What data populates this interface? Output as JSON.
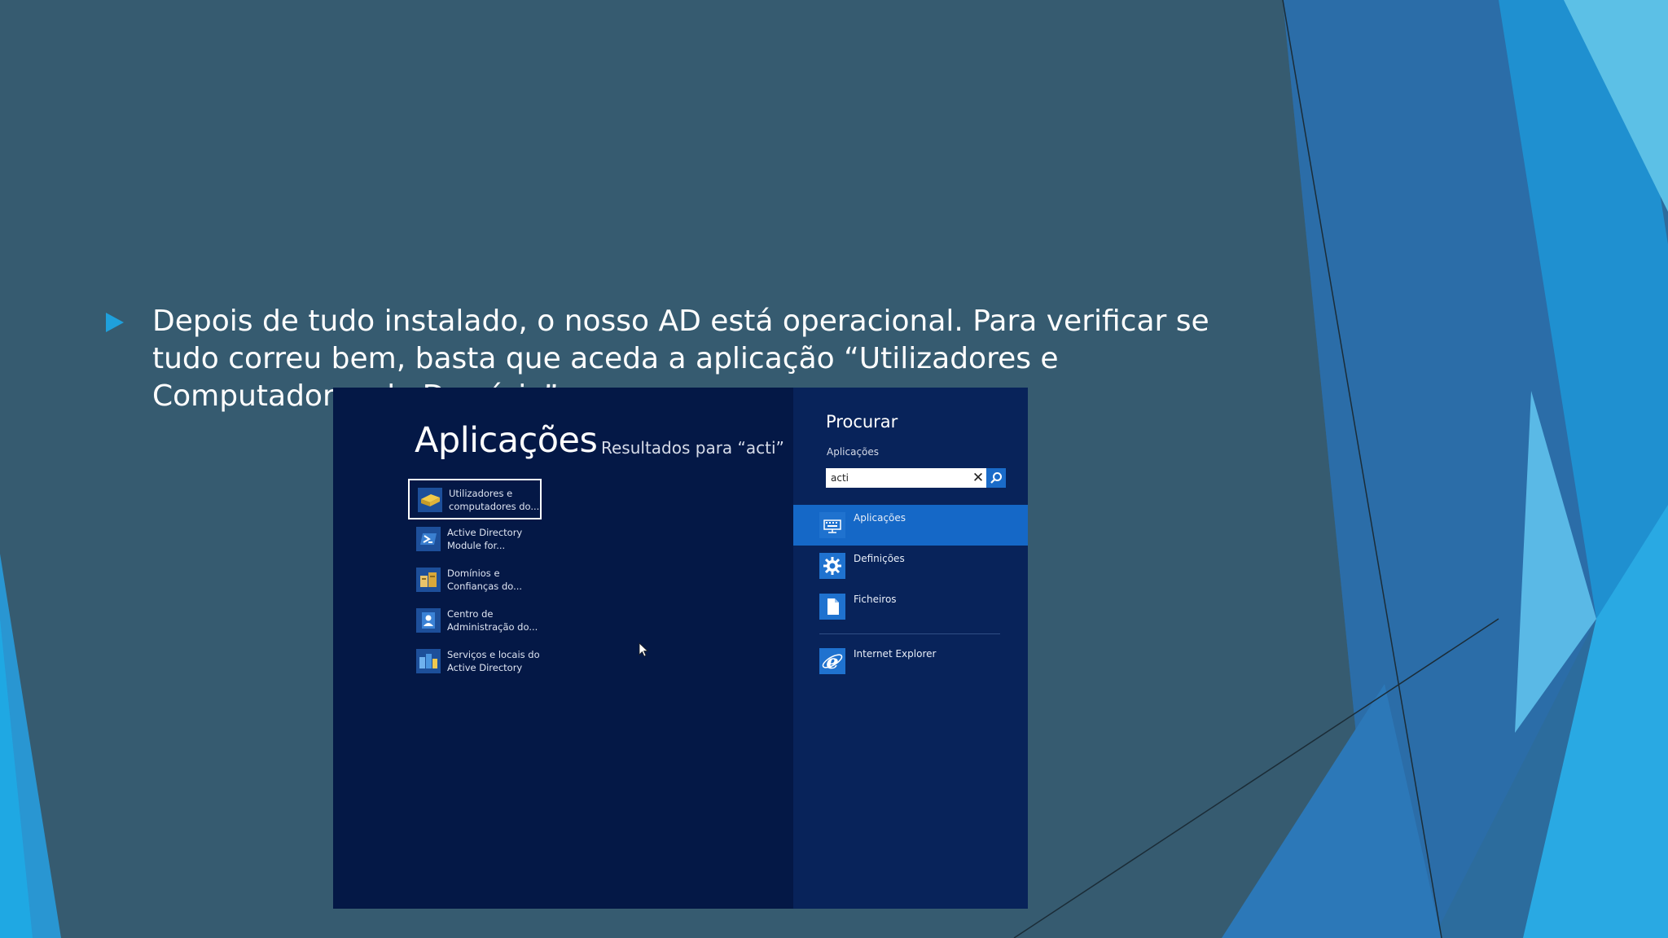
{
  "slide": {
    "bullet_text": "Depois de tudo instalado, o nosso AD está operacional. Para verificar se tudo correu bem, basta que aceda a aplicação “Utilizadores e Computadores do Domínio”"
  },
  "start_screen": {
    "title": "Aplicações",
    "results_heading": "Resultados para “acti”",
    "results": [
      {
        "label": "Utilizadores e computadores do...",
        "icon": "ad-users-icon",
        "selected": true
      },
      {
        "label": "Active Directory Module for...",
        "icon": "powershell-icon"
      },
      {
        "label": "Domínios e Confianças do...",
        "icon": "domains-trusts-icon"
      },
      {
        "label": "Centro de Administração do...",
        "icon": "admin-center-icon"
      },
      {
        "label": "Serviços e locais do Active Directory",
        "icon": "sites-services-icon"
      }
    ]
  },
  "search_pane": {
    "title": "Procurar",
    "scope": "Aplicações",
    "query": "acti",
    "scopes": [
      {
        "label": "Aplicações",
        "icon": "apps-keyboard-icon",
        "active": true
      },
      {
        "label": "Definições",
        "icon": "settings-gear-icon"
      },
      {
        "label": "Ficheiros",
        "icon": "file-icon"
      }
    ],
    "app_result": {
      "label": "Internet Explorer",
      "icon": "internet-explorer-icon"
    }
  },
  "colors": {
    "slide_bg": "#365b70",
    "accent": "#1fa0dc",
    "start_bg": "#041846",
    "search_bg": "#08235a",
    "active_scope": "#1568c7"
  }
}
